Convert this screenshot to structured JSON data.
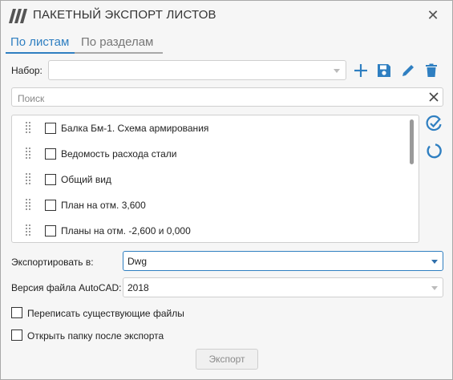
{
  "window": {
    "title": "ПАКЕТНЫЙ ЭКСПОРТ ЛИСТОВ",
    "close_glyph": "✕",
    "accent_color": "#2f7fc1"
  },
  "tabs": [
    {
      "label": "По листам",
      "active": true
    },
    {
      "label": "По разделам",
      "active": false
    }
  ],
  "set": {
    "label": "Набор:",
    "value": "",
    "icons": [
      "plus-icon",
      "save-icon",
      "pencil-icon",
      "trash-icon"
    ]
  },
  "search": {
    "placeholder": "Поиск",
    "value": ""
  },
  "sheets": [
    {
      "label": "Балка Бм-1. Схема армирования",
      "checked": false
    },
    {
      "label": "Ведомость расхода стали",
      "checked": false
    },
    {
      "label": "Общий вид",
      "checked": false
    },
    {
      "label": "План на отм. 3,600",
      "checked": false
    },
    {
      "label": "Планы на отм. -2,600 и 0,000",
      "checked": false
    }
  ],
  "side_actions": [
    "select-all-icon",
    "refresh-icon"
  ],
  "export_format": {
    "label": "Экспортировать в:",
    "value": "Dwg"
  },
  "autocad_version": {
    "label": "Версия файла AutoCAD:",
    "value": "2018"
  },
  "options": [
    {
      "label": "Переписать существующие файлы",
      "checked": false
    },
    {
      "label": "Открыть папку после экспорта",
      "checked": false
    }
  ],
  "export_button": "Экспорт"
}
